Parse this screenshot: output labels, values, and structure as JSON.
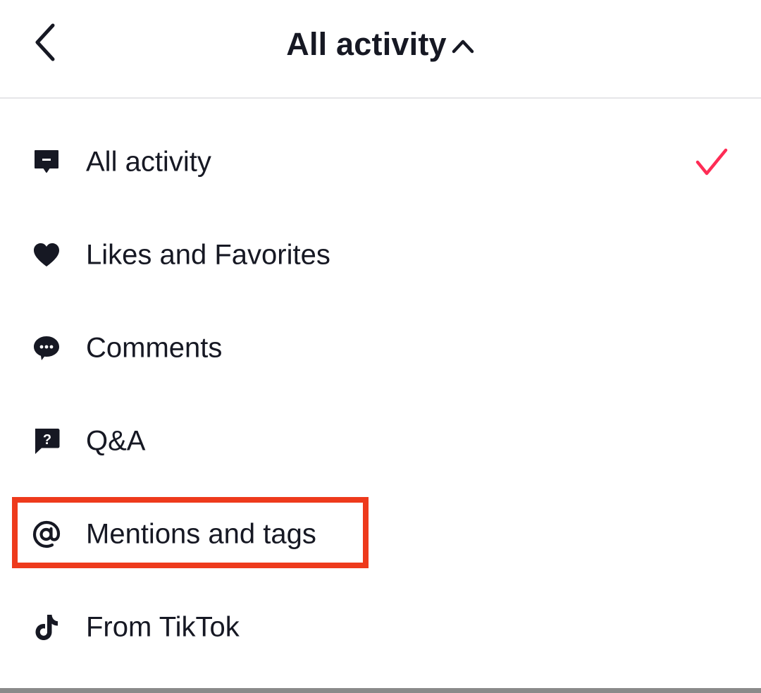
{
  "header": {
    "title": "All activity",
    "back_icon": "chevron-left-icon",
    "toggle_icon": "chevron-up-icon"
  },
  "menu": {
    "items": [
      {
        "label": "All activity",
        "icon": "message-icon",
        "selected": true
      },
      {
        "label": "Likes and Favorites",
        "icon": "heart-icon",
        "selected": false
      },
      {
        "label": "Comments",
        "icon": "comment-bubble-icon",
        "selected": false
      },
      {
        "label": "Q&A",
        "icon": "question-icon",
        "selected": false
      },
      {
        "label": "Mentions and tags",
        "icon": "at-icon",
        "selected": false,
        "highlighted": true
      },
      {
        "label": "From TikTok",
        "icon": "tiktok-icon",
        "selected": false
      }
    ]
  },
  "colors": {
    "text": "#161823",
    "check": "#fe2c55",
    "highlight": "#ee3a1c",
    "divider": "#e6e6e8"
  }
}
